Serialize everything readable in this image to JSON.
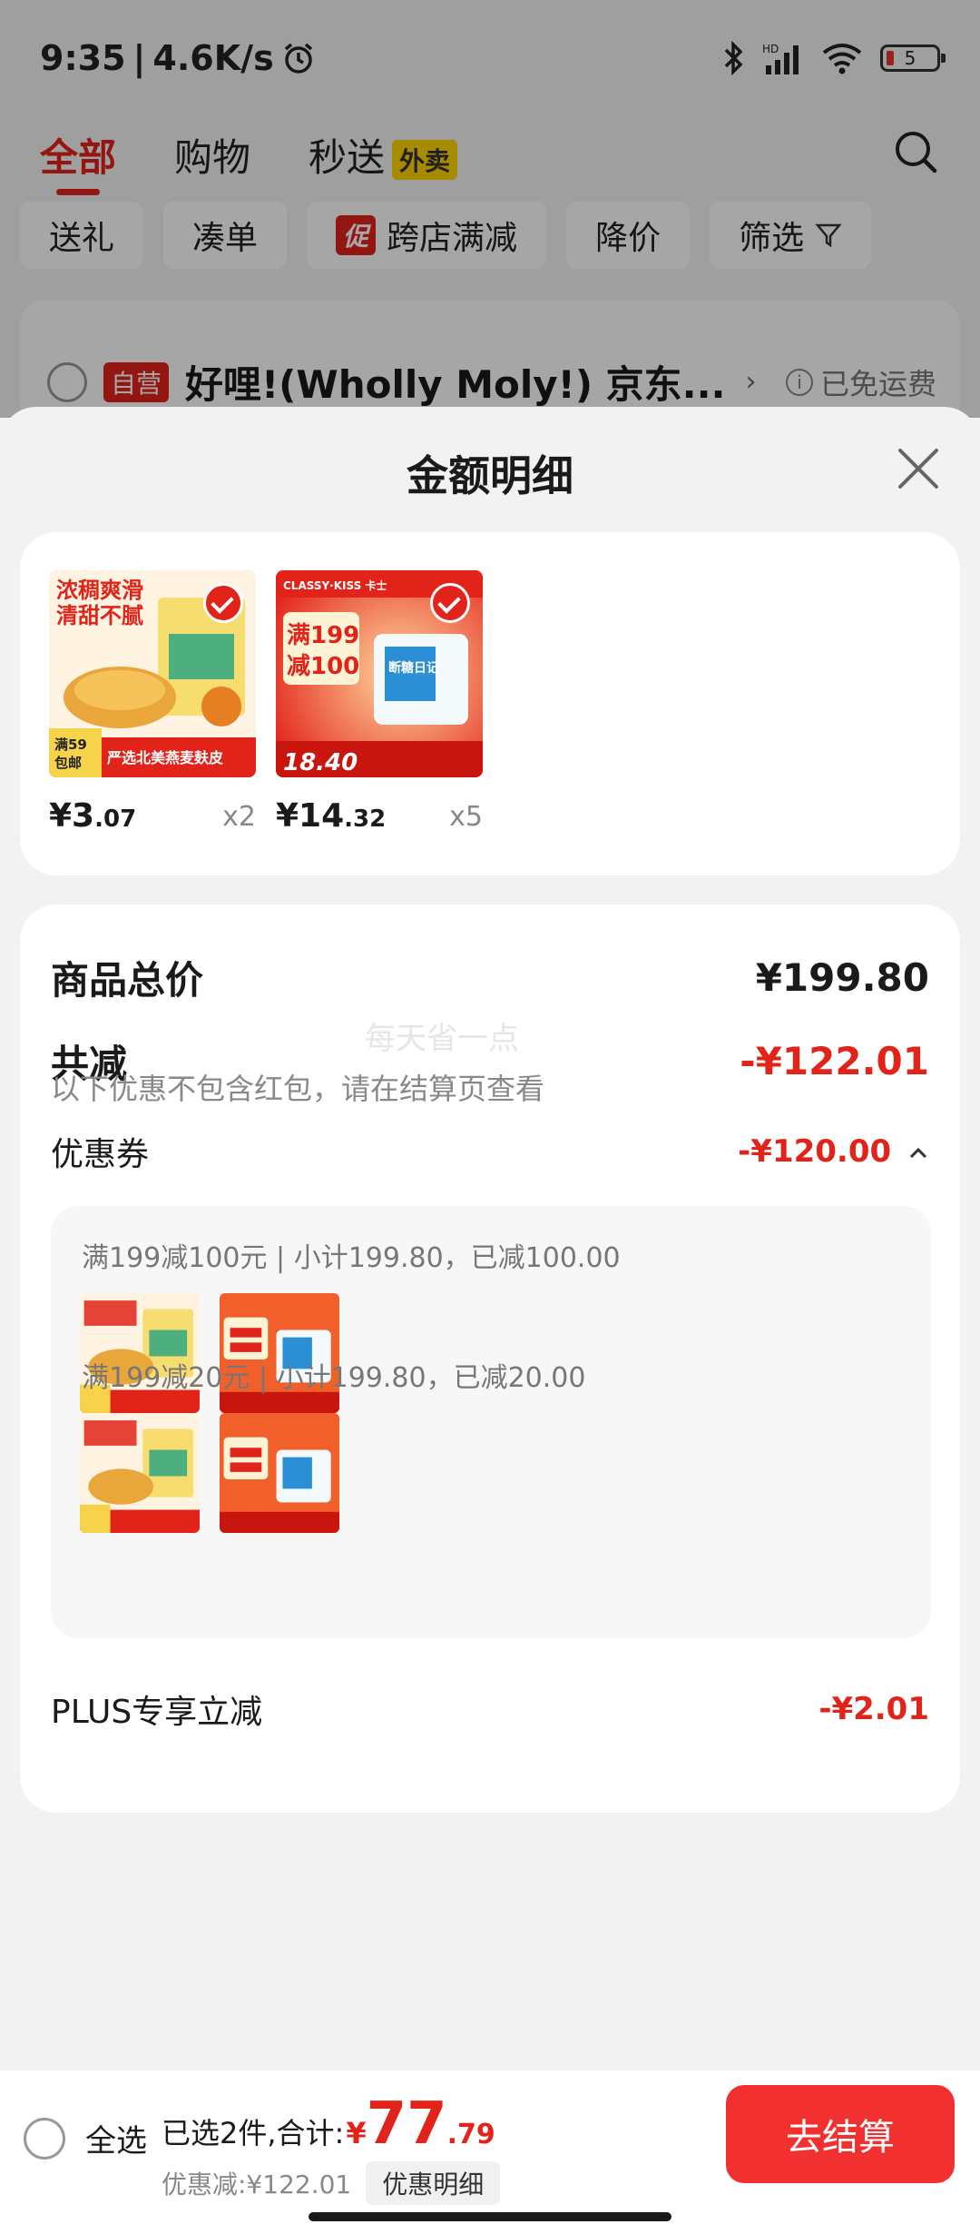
{
  "status": {
    "time": "9:35",
    "speed": "4.6K/s",
    "network": "HD",
    "battery": "5"
  },
  "tabs": [
    {
      "label": "全部"
    },
    {
      "label": "购物"
    },
    {
      "label": "秒送",
      "badge": "外卖"
    }
  ],
  "chips": [
    "送礼",
    "凑单",
    "跨店满减",
    "降价",
    "筛选"
  ],
  "chip_promo_tag": "促",
  "shop": {
    "tag": "自营",
    "name": "好哩!(Wholly Moly!) 京东...",
    "freeship": "已免运费"
  },
  "sheet": {
    "title": "金额明细"
  },
  "products": [
    {
      "price_int": "¥3",
      "price_dec": ".07",
      "qty": "x2",
      "img_text": [
        "浓稠爽滑",
        "清甜不腻",
        "满59",
        "包邮",
        "严选北美燕麦麸皮"
      ]
    },
    {
      "price_int": "¥14",
      "price_dec": ".32",
      "qty": "x5",
      "img_text": [
        "满199",
        "减100",
        "18.40",
        "CLASSY·KISS 卡士",
        "断糖日记"
      ]
    }
  ],
  "summary": {
    "total_label": "商品总价",
    "total_value": "¥199.80",
    "reduce_label": "共减",
    "reduce_value": "-¥122.01",
    "reduce_note": "以下优惠不包含红包，请在结算页查看",
    "watermark": "每天省一点",
    "coupon_label": "优惠券",
    "coupon_value": "-¥120.00",
    "coupon_lines": [
      "满199减100元 | 小计199.80，已减100.00",
      "满199减20元 | 小计199.80，已减20.00"
    ],
    "plus_label": "PLUS专享立减",
    "plus_value": "-¥2.01"
  },
  "bottom": {
    "select_all": "全选",
    "total_prefix": "已选2件,合计:",
    "currency": "¥",
    "total_int": "77",
    "total_dec": ".79",
    "discount_text": "优惠减:¥122.01",
    "discount_button": "优惠明细",
    "checkout": "去结算"
  },
  "colors": {
    "accent": "#e2231a",
    "checkout": "#f23030"
  }
}
